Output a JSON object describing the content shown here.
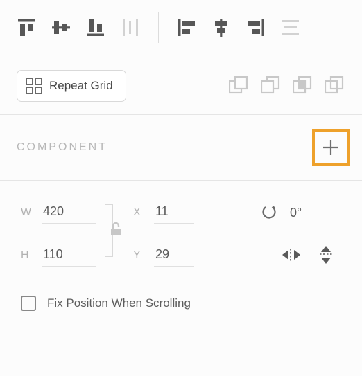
{
  "repeat": {
    "label": "Repeat Grid"
  },
  "component": {
    "label": "COMPONENT"
  },
  "transform": {
    "w_label": "W",
    "w": "420",
    "h_label": "H",
    "h": "110",
    "x_label": "X",
    "x": "11",
    "y_label": "Y",
    "y": "29",
    "rotation": "0°"
  },
  "fix": {
    "label": "Fix Position When Scrolling"
  }
}
